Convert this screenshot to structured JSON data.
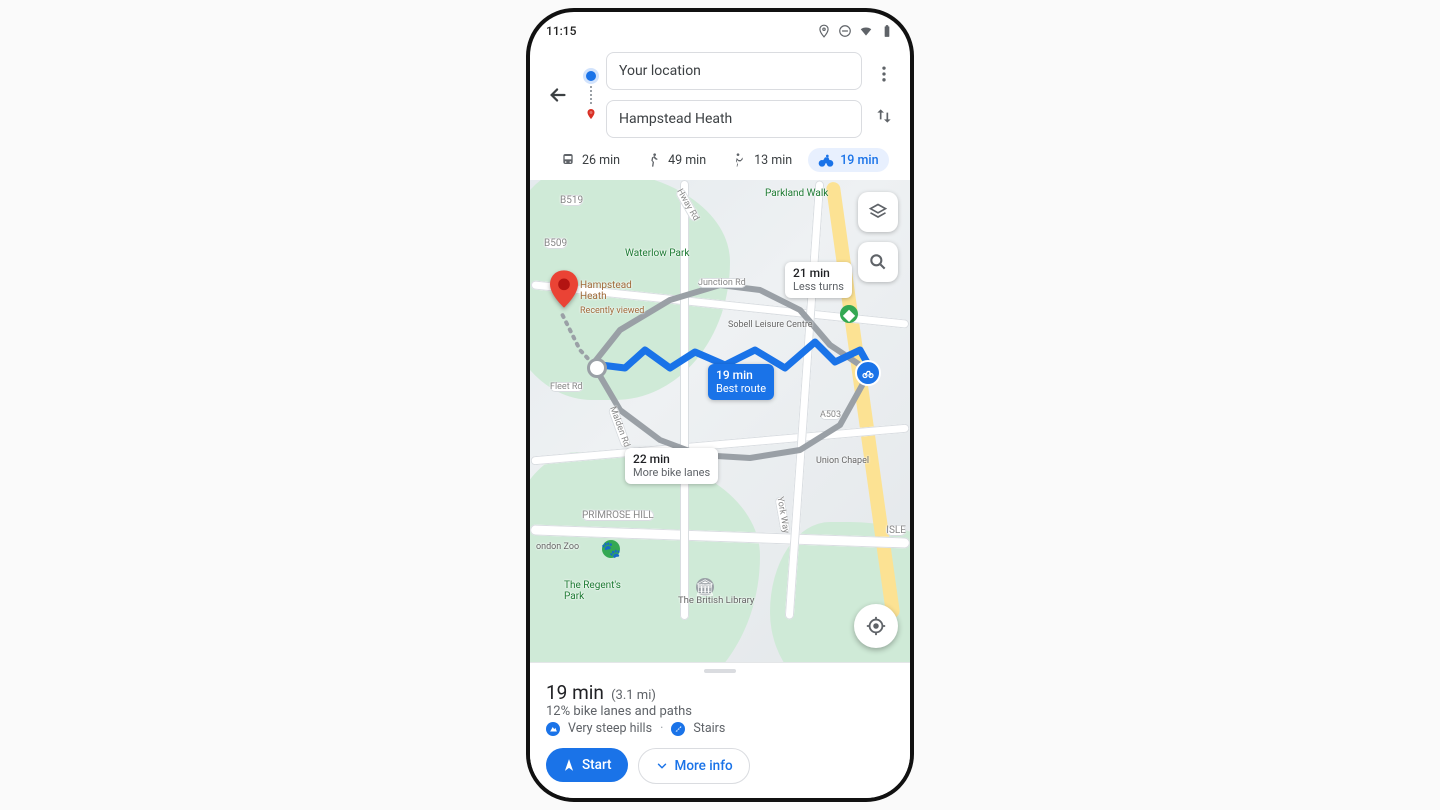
{
  "status": {
    "time": "11:15"
  },
  "directions": {
    "from": "Your location",
    "to": "Hampstead Heath"
  },
  "modes": [
    {
      "icon": "transit",
      "label": "26 min"
    },
    {
      "icon": "walk",
      "label": "49 min"
    },
    {
      "icon": "ride",
      "label": "13 min"
    },
    {
      "icon": "cycle",
      "label": "19 min"
    }
  ],
  "map": {
    "dest_label": "Hampstead\nHeath",
    "dest_sub": "Recently viewed",
    "labels": {
      "parkland": "Parkland Walk",
      "waterlow": "Waterlow Park",
      "sobell": "Sobell Leisure Centre",
      "unionchapel": "Union Chapel",
      "primrose": "PRIMROSE HILL",
      "regents": "The Regent's\nPark",
      "britishlib": "The British Library",
      "isle": "ISLE",
      "zoo": "ondon Zoo",
      "b509": "B509",
      "b519": "B519",
      "a503": "A503",
      "junction": "Junction Rd",
      "fleet": "Fleet Rd",
      "malden": "Malden Rd",
      "york": "York Way",
      "hway": "Hway Rd"
    },
    "alt1": {
      "time": "21 min",
      "note": "Less turns"
    },
    "best": {
      "time": "19 min",
      "note": "Best route"
    },
    "alt2": {
      "time": "22 min",
      "note": "More bike lanes"
    }
  },
  "summary": {
    "time": "19 min",
    "dist": "(3.1 mi)",
    "lanes": "12% bike lanes and paths",
    "tag1": "Very steep hills",
    "tag2": "Stairs",
    "start": "Start",
    "moreinfo": "More info"
  }
}
